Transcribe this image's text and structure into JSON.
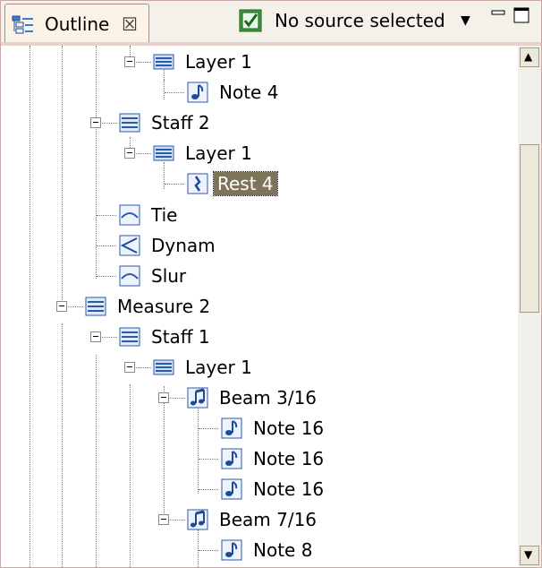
{
  "view": {
    "tab_title": "Outline",
    "tab_close": "☒",
    "source_label": "No source selected",
    "source_arrow": "▼"
  },
  "tree": [
    {
      "label": "Layer 1",
      "icon": "layer-icon"
    },
    {
      "label": "Note 4",
      "icon": "note-icon"
    },
    {
      "label": "Staff 2",
      "icon": "staff-icon"
    },
    {
      "label": "Layer 1",
      "icon": "layer-icon"
    },
    {
      "label": "Rest 4",
      "icon": "rest-icon",
      "selected": true
    },
    {
      "label": "Tie",
      "icon": "tie-icon"
    },
    {
      "label": "Dynam",
      "icon": "dynamic-icon"
    },
    {
      "label": "Slur",
      "icon": "slur-icon"
    },
    {
      "label": "Measure 2",
      "icon": "measure-icon"
    },
    {
      "label": "Staff 1",
      "icon": "staff-icon"
    },
    {
      "label": "Layer 1",
      "icon": "layer-icon"
    },
    {
      "label": "Beam 3/16",
      "icon": "beam-icon"
    },
    {
      "label": "Note 16",
      "icon": "note-icon"
    },
    {
      "label": "Note 16",
      "icon": "note-icon"
    },
    {
      "label": "Note 16",
      "icon": "note-icon"
    },
    {
      "label": "Beam 7/16",
      "icon": "beam-icon"
    },
    {
      "label": "Note 8",
      "icon": "note-icon"
    }
  ],
  "scrollbar": {
    "up_arrow": "▲",
    "down_arrow": "▼"
  }
}
